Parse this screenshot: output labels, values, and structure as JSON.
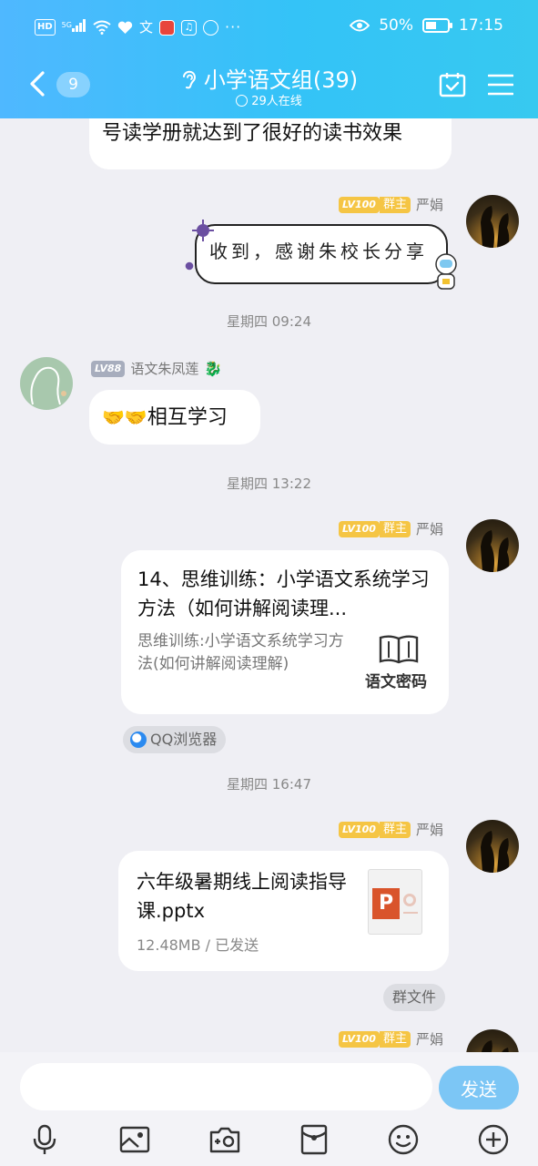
{
  "status_bar": {
    "network": "HD",
    "signal_label": "5G",
    "battery": "50%",
    "battery_level": 0.5,
    "time": "17:15"
  },
  "header": {
    "unread_count": "9",
    "title": "小学语文组(39)",
    "online": "29人在线"
  },
  "messages": {
    "m1": {
      "text": "号读学册就达到了很好的读书效果"
    },
    "m2": {
      "level": "LV100",
      "role": "群主",
      "sender": "严娟",
      "sticker_text": "收到，感谢朱校长分享"
    },
    "t1": "星期四 09:24",
    "m3": {
      "level": "LV88",
      "sender": "语文朱凤莲",
      "emoji": "🤝🤝",
      "text": "相互学习"
    },
    "t2": "星期四 13:22",
    "m4": {
      "level": "LV100",
      "role": "群主",
      "sender": "严娟",
      "title": "14、思维训练：小学语文系统学习方法（如何讲解阅读理...",
      "desc": "思维训练:小学语文系统学习方法(如何讲解阅读理解)",
      "thumb_label": "语文密码",
      "source": "QQ浏览器"
    },
    "t3": "星期四 16:47",
    "m5": {
      "level": "LV100",
      "role": "群主",
      "sender": "严娟",
      "file_name": "六年级暑期线上阅读指导课.pptx",
      "file_meta": "12.48MB / 已发送",
      "file_icon_letter": "P",
      "tag": "群文件"
    },
    "m6": {
      "level": "LV100",
      "role": "群主",
      "sender": "严娟"
    }
  },
  "input": {
    "placeholder": "",
    "send_label": "发送"
  },
  "toolbar": [
    "mic-icon",
    "image-icon",
    "camera-icon",
    "red-envelope-icon",
    "emoji-icon",
    "plus-icon"
  ]
}
